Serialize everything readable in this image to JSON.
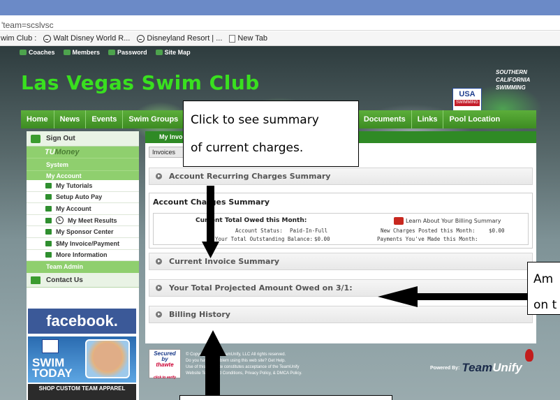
{
  "browser": {
    "url_fragment": "'team=scslvsc",
    "bookmarks": [
      "wim Club :",
      "Walt Disney World R...",
      "Disneyland Resort | ...",
      "New Tab"
    ]
  },
  "site": {
    "top_nav": [
      "Coaches",
      "Members",
      "Password",
      "Site Map"
    ],
    "title": "Las Vegas Swim Club",
    "usa_logo": {
      "line1": "USA",
      "line2": "SWIMMING"
    },
    "region": [
      "SOUTHERN",
      "CALIFORNIA",
      "SWIMMING"
    ],
    "main_menu": [
      "Home",
      "News",
      "Events",
      "Swim Groups",
      "ars",
      "Documents",
      "Links",
      "Pool Location"
    ]
  },
  "sidebar": {
    "sign_out": "Sign Out",
    "tu_money": {
      "tu": "TU",
      "money": "Money"
    },
    "system": "System",
    "my_account_header": "My Account",
    "items": [
      "My Tutorials",
      "Setup Auto Pay",
      "My Account",
      "My Meet Results",
      "My Sponsor Center",
      "$My Invoice/Payment",
      "More Information"
    ],
    "team_admin": "Team Admin",
    "contact_us": "Contact Us",
    "facebook": "facebook.",
    "swim_today": {
      "line1": "SWIM",
      "line2": "TODAY"
    },
    "apparel": "SHOP CUSTOM TEAM APPAREL"
  },
  "content": {
    "header": "My Invo",
    "tab": "Invoices",
    "recurring": "Account Recurring Charges Summary",
    "account_charges": {
      "title": "Account Charges Summary",
      "owed_label": "Current Total Owed this Month:",
      "status_label": "Account Status:",
      "status_value": "Paid-In-Full",
      "outstanding_label": "Your Total Outstanding Balance:",
      "outstanding_value": "$0.00",
      "learn_link": "Learn About Your Billing Summary",
      "new_charges_label": "New Charges Posted this Month:",
      "new_charges_value": "$0.00",
      "payments_label": "Payments You've Made this Month:"
    },
    "current_invoice": "Current Invoice Summary",
    "projected": "Your Total Projected Amount Owed on 3/1:",
    "billing_history": "Billing History"
  },
  "footer": {
    "secured": {
      "line1": "Secured",
      "line2": "by",
      "brand": "thawte",
      "verify": "click to verify"
    },
    "line1": "© Copyright 2014. TeamUnify, LLC All rights reserved.",
    "line2": "Do you have a problem using this web site? Get Help.",
    "line3": "Use of this Web site constitutes acceptance of the TeamUnify",
    "line4": "Website Terms and Conditions, Privacy Policy, & DMCA Policy.",
    "powered_by": "Powered By:",
    "brand_team": "Team",
    "brand_unify": "Unify"
  },
  "annotations": {
    "callout_line1": "Click to see summary",
    "callout_line2": "of current charges.",
    "right_line1": "Am",
    "right_line2": "on t"
  }
}
